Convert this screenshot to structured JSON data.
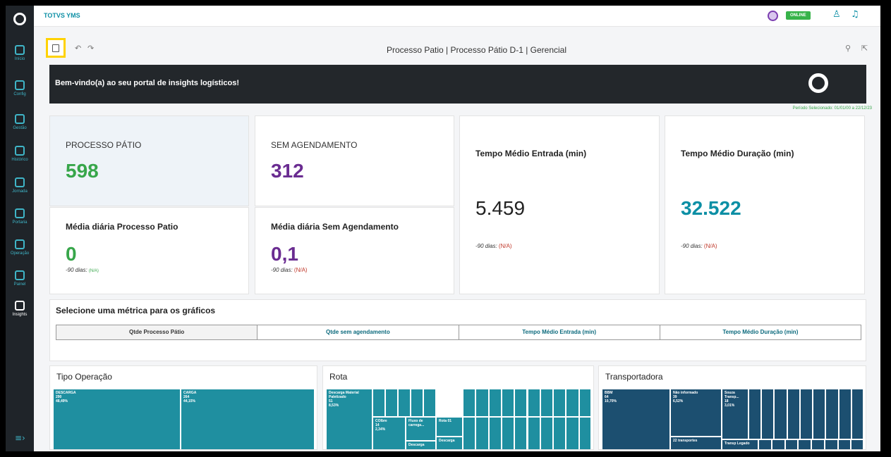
{
  "sidebar": {
    "items": [
      {
        "label": "Início",
        "icon": "home-icon"
      },
      {
        "label": "Config",
        "icon": "config-icon"
      },
      {
        "label": "Gestão",
        "icon": "chart-icon"
      },
      {
        "label": "Histórico",
        "icon": "calendar-icon"
      },
      {
        "label": "Jornada",
        "icon": "pin-icon"
      },
      {
        "label": "Portaria",
        "icon": "truck-icon"
      },
      {
        "label": "Operação",
        "icon": "building-icon"
      },
      {
        "label": "Painel",
        "icon": "monitor-icon"
      },
      {
        "label": "Insights",
        "icon": "insights-icon"
      }
    ],
    "bottom_icon": "expand-icon"
  },
  "topbar": {
    "brand": "TOTVS YMS",
    "status_badge": "ONLINE"
  },
  "toolbar": {
    "page_title": "Processo Patio | Processo Pátio D-1 | Gerencial"
  },
  "banner": {
    "text": "Bem-vindo(a) ao seu portal de insights logísticos!"
  },
  "period": "Período Selecionado: 01/01/00 a 22/12/23",
  "cards": {
    "processo_patio": {
      "title": "PROCESSO PÁTIO",
      "value": "598",
      "color": "#37a64a"
    },
    "sem_agendamento": {
      "title": "SEM AGENDAMENTO",
      "value": "312",
      "color": "#6a2c91"
    },
    "tempo_entrada": {
      "title": "Tempo Médio Entrada (min)",
      "value": "5.459",
      "sub_label": "-90 dias:",
      "sub_value": "(N/A)"
    },
    "tempo_duracao": {
      "title": "Tempo Médio Duração (min)",
      "value": "32.522",
      "color": "#0c8fa5",
      "sub_label": "-90 dias:",
      "sub_value": "(N/A)"
    },
    "media_patio": {
      "title": "Média diária Processo Patio",
      "value": "0",
      "color": "#37a64a",
      "sub_label": "-90 dias:",
      "sub_value": "(N/A)"
    },
    "media_sem_ag": {
      "title": "Média diária Sem Agendamento",
      "value": "0,1",
      "color": "#6a2c91",
      "sub_label": "-90 dias:",
      "sub_value": "(N/A)"
    }
  },
  "metric": {
    "title": "Selecione uma métrica para os gráficos",
    "tabs": [
      "Qtde Processo Pátio",
      "Qtde sem agendamento",
      "Tempo Médio Entrada (min)",
      "Tempo Médio Duração (min)"
    ]
  },
  "panels": {
    "tipo_operacao": {
      "title": "Tipo Operação",
      "cells": [
        {
          "name": "DESCARGA",
          "value": "290",
          "pct": "48,49%"
        },
        {
          "name": "CARGA",
          "value": "264",
          "pct": "44,15%"
        }
      ]
    },
    "rota": {
      "title": "Rota",
      "cells": [
        {
          "name": "Descarga Material Paletizado",
          "value": "51",
          "pct": "8,53%"
        },
        {
          "name": "COlbre",
          "value": "14",
          "pct": "2,34%"
        },
        {
          "name": "Fluxo de carrega...",
          "value": "",
          "pct": ""
        },
        {
          "name": "Rota 01",
          "value": "",
          "pct": ""
        },
        {
          "name": "Descarga",
          "value": "",
          "pct": ""
        },
        {
          "name": "Descarga",
          "value": "",
          "pct": ""
        }
      ]
    },
    "transportadora": {
      "title": "Transportadora",
      "cells": [
        {
          "name": "BBM",
          "value": "64",
          "pct": "10,70%"
        },
        {
          "name": "Não informado",
          "value": "39",
          "pct": "6,52%"
        },
        {
          "name": "Souza Transp...",
          "value": "18",
          "pct": "3,01%"
        },
        {
          "name": "22 transportes",
          "value": "",
          "pct": ""
        },
        {
          "name": "Transp Legado",
          "value": "",
          "pct": ""
        }
      ]
    }
  },
  "colors": {
    "accent": "#0c8fa5",
    "treemap_main": "#1f8fa0",
    "treemap_dark": "#1c4f70"
  }
}
